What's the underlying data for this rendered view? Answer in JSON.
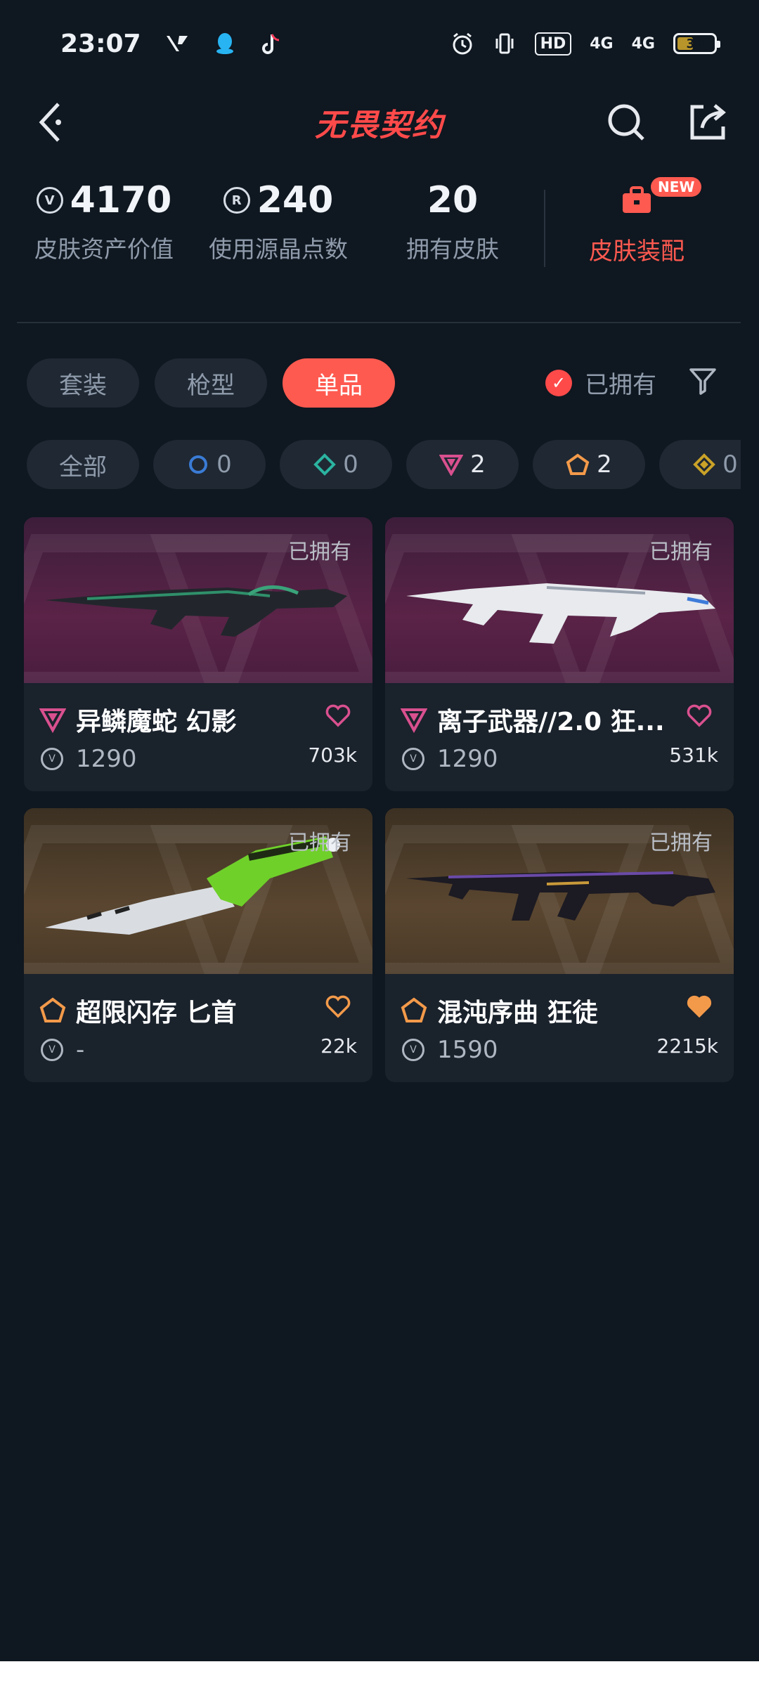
{
  "status_bar": {
    "time": "23:07",
    "hd_badge": "HD",
    "network": "4G",
    "battery": "39"
  },
  "header": {
    "title": "无畏契约"
  },
  "stats": {
    "asset_value": "4170",
    "asset_value_label": "皮肤资产价值",
    "rp_points": "240",
    "rp_points_label": "使用源晶点数",
    "skins_owned": "20",
    "skins_owned_label": "拥有皮肤",
    "outfit_label": "皮肤装配",
    "new_badge": "NEW"
  },
  "tabs": [
    {
      "label": "套装"
    },
    {
      "label": "枪型"
    },
    {
      "label": "单品"
    }
  ],
  "owned_filter": {
    "label": "已拥有",
    "checked": true
  },
  "tier_chips": [
    {
      "label": "全部"
    },
    {
      "count": "0",
      "tier": "select-tier-blue"
    },
    {
      "count": "0",
      "tier": "deluxe-tier-teal"
    },
    {
      "count": "2",
      "tier": "premium-tier-pink"
    },
    {
      "count": "2",
      "tier": "exclusive-tier-orange"
    },
    {
      "count": "0",
      "tier": "ultra-tier-gold"
    }
  ],
  "cards": [
    {
      "name": "异鳞魔蛇 幻影",
      "price": "1290",
      "likes": "703k",
      "owned": "已拥有",
      "tier": "premium",
      "favorited": false
    },
    {
      "name": "离子武器//2.0 狂...",
      "price": "1290",
      "likes": "531k",
      "owned": "已拥有",
      "tier": "premium",
      "favorited": false
    },
    {
      "name": "超限闪存 匕首",
      "price": "-",
      "likes": "22k",
      "owned": "已拥有",
      "tier": "exclusive",
      "favorited": false
    },
    {
      "name": "混沌序曲 狂徒",
      "price": "1590",
      "likes": "2215k",
      "owned": "已拥有",
      "tier": "exclusive",
      "favorited": true
    }
  ],
  "colors": {
    "accent": "#ff5a50",
    "premium_tier": "#d9508f",
    "exclusive_tier": "#f39a4a",
    "background": "#0f1720"
  }
}
